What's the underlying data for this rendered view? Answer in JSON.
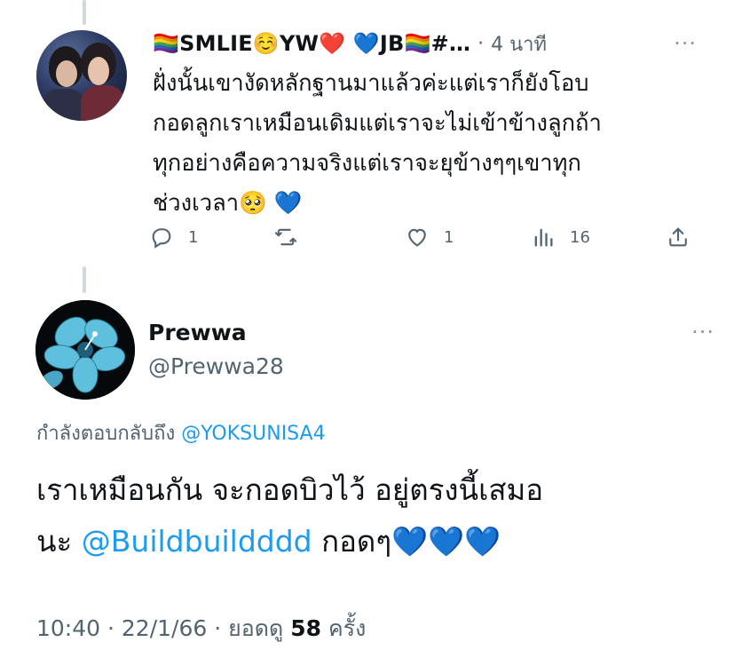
{
  "reply": {
    "display_name": "🏳️‍🌈SMLIE☺️YW❤️ 💙JB🏳️‍🌈#…",
    "separator": "·",
    "time_ago": "4 นาที",
    "more": "···",
    "text_lines": [
      "ฝั่งนั้นเขางัดหลักฐานมาแล้วค่ะแต่เราก็ยังโอบ",
      "กอดลูกเราเหมือนเดิมแต่เราจะไม่เข้าข้างลูกถ้า",
      "ทุกอย่างคือความจริงแต่เราจะยุข้างๆๆเขาทุก",
      "ช่วงเวลา🥺 💙"
    ],
    "actions": {
      "reply_count": "1",
      "retweet_count": "",
      "like_count": "1",
      "views_count": "16"
    },
    "icons": {
      "reply": "reply-icon",
      "retweet": "retweet-icon",
      "like": "like-icon",
      "views": "views-icon",
      "share": "share-icon"
    }
  },
  "tweet": {
    "author_name": "Prewwa",
    "author_handle": "@Prewwa28",
    "more": "···",
    "replying_prefix": "กำลังตอบกลับถึง ",
    "replying_to": "@YOKSUNISA4",
    "text_line1": "เราเหมือนกัน จะกอดบิวไว้ อยู่ตรงนี้เสมอ",
    "text_line2_prefix": "นะ ",
    "text_mention": "@Buildbuildddd",
    "text_line2_suffix": " กอดๆ",
    "text_hearts": "💙💙💙",
    "time": "10:40",
    "date": "22/1/66",
    "views_label": "ยอดดู",
    "views_count": "58",
    "views_unit": "ครั้ง",
    "separator": "·"
  },
  "colors": {
    "accent": "#1d9bf0",
    "secondary_text": "#536471",
    "primary_text": "#0f1419",
    "thread_line": "#cfd9de"
  }
}
